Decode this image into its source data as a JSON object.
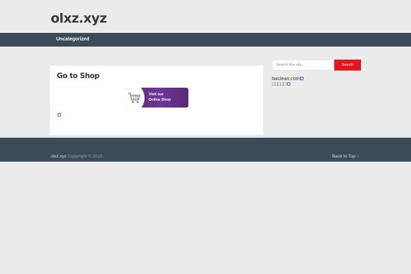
{
  "site": {
    "title": "olxz.xyz"
  },
  "nav": {
    "items": [
      {
        "label": "Uncategorized"
      }
    ]
  },
  "main": {
    "card_title": "Go to Shop",
    "banner": {
      "line1": "Visit our",
      "line2": "Online Shop"
    }
  },
  "sidebar": {
    "search": {
      "placeholder": "Search this site...",
      "button_label": "Search"
    },
    "links": [
      {
        "label": "twiclean.com"
      },
      {
        "label": "□□□□□"
      }
    ]
  },
  "footer": {
    "site_name": "olxz.xyz",
    "copyright": " Copyright © 2015.",
    "back_to_top": "Back to Top ↑"
  },
  "colors": {
    "page_background": "#ebebeb",
    "navbar": "#3c4b5a",
    "search_button": "#e3171e",
    "banner_purple": "#6d3891"
  }
}
